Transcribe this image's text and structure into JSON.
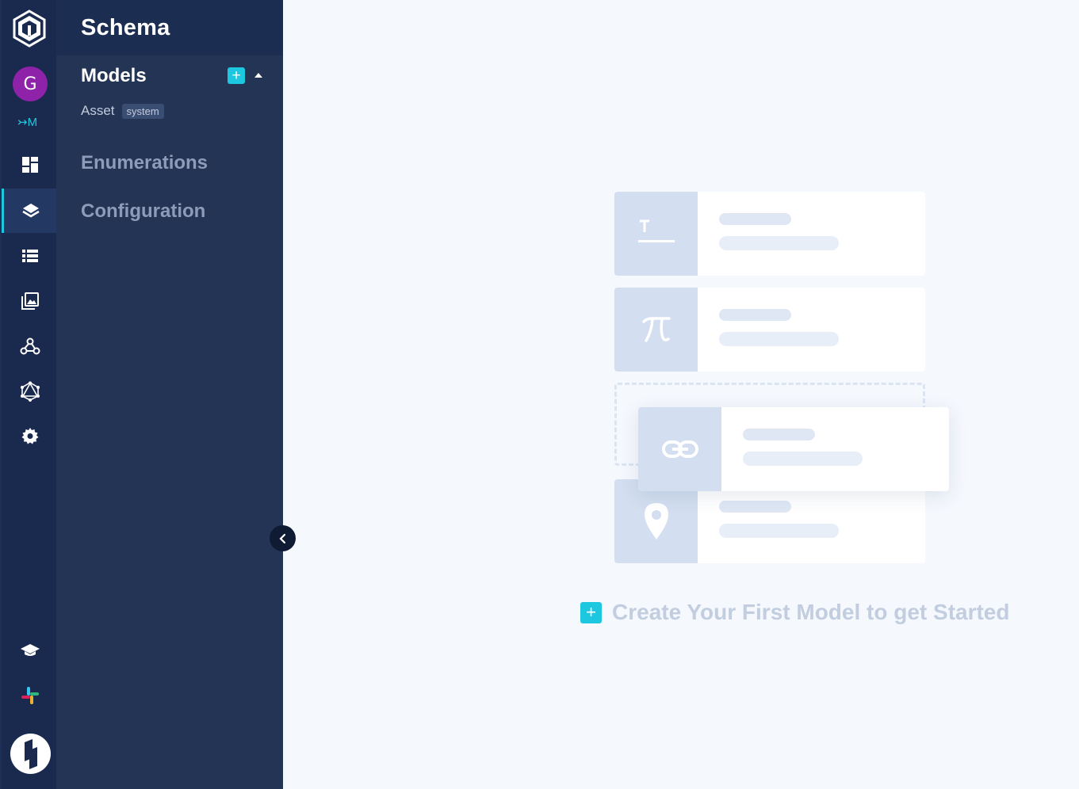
{
  "rail": {
    "avatar_initial": "G",
    "env_label": "↣M"
  },
  "sidebar": {
    "title": "Schema",
    "models_label": "Models",
    "models_add": "+",
    "models": [
      {
        "name": "Asset",
        "badge": "system"
      }
    ],
    "enumerations_label": "Enumerations",
    "configuration_label": "Configuration"
  },
  "empty_state": {
    "cta_plus": "+",
    "cta_text": "Create Your First Model to get Started",
    "card_icons": [
      "text-field-icon",
      "pi-icon",
      "link-icon",
      "location-pin-icon"
    ]
  },
  "colors": {
    "rail_bg": "#1a2a4f",
    "sidebar_bg": "#233455",
    "accent": "#1ec7e0",
    "avatar": "#8e22a8",
    "main_bg": "#f5f8fd"
  }
}
